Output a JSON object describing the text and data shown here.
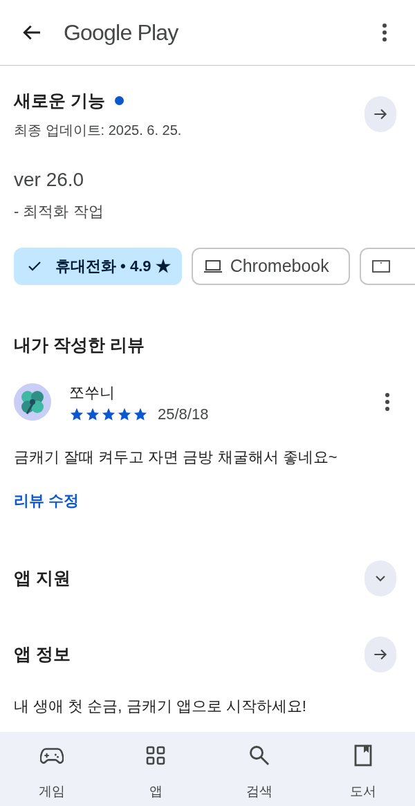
{
  "header": {
    "title": "Google Play"
  },
  "whats_new": {
    "title": "새로운 기능",
    "new_dot": true,
    "updated": "최종 업데이트: 2025. 6. 25.",
    "version": "ver 26.0",
    "notes": "- 최적화 작업"
  },
  "device_chips": [
    {
      "kind": "phone",
      "label": "휴대전화 • 4.9 ★",
      "selected": true
    },
    {
      "kind": "laptop",
      "label": "Chromebook",
      "selected": false
    },
    {
      "kind": "tablet",
      "selected": false
    }
  ],
  "my_review": {
    "heading": "내가 작성한 리뷰",
    "author": "쪼쑤니",
    "stars": 5,
    "date": "25/8/18",
    "text": "금캐기 잘때 켜두고 자면 금방 채굴해서 좋네요~",
    "edit_link": "리뷰 수정"
  },
  "sections": [
    {
      "title": "앱 지원",
      "kind": "expand"
    },
    {
      "title": "앱 정보",
      "kind": "open",
      "description": "내 생애 첫 순금, 금캐기 앱으로 시작하세요!"
    }
  ],
  "bottom_nav": [
    {
      "kind": "games",
      "label": "게임",
      "selected": false
    },
    {
      "kind": "apps",
      "label": "앱",
      "selected": false
    },
    {
      "kind": "search",
      "label": "검색",
      "selected": false
    },
    {
      "kind": "books",
      "label": "도서",
      "selected": false
    }
  ]
}
